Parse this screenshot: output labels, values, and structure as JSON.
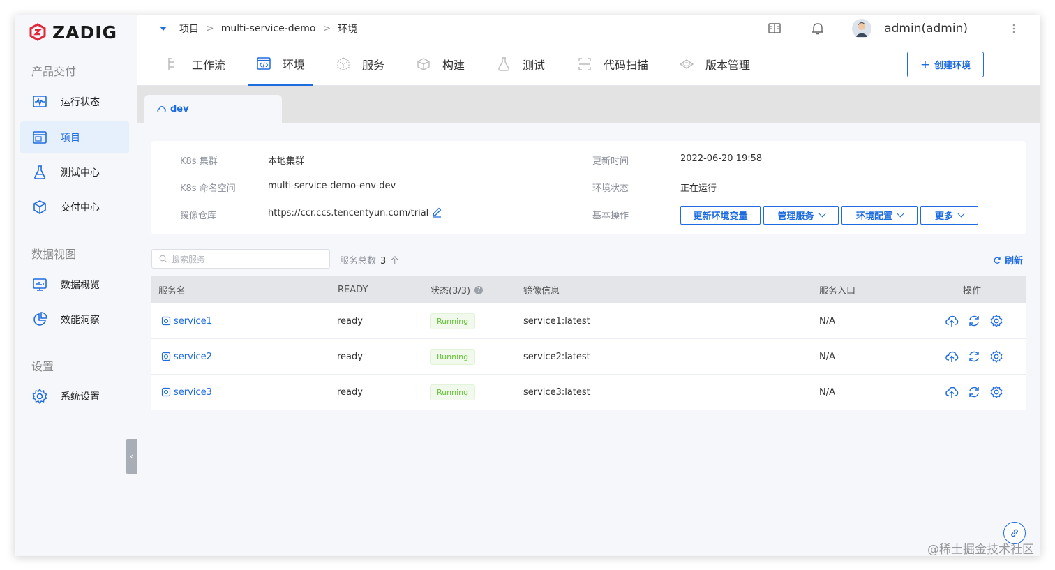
{
  "app": {
    "logo_text": "ZADIG"
  },
  "sidebar": {
    "sections": [
      "产品交付",
      "数据视图",
      "设置"
    ],
    "items": [
      {
        "label": "运行状态",
        "icon": "pulse-monitor-icon"
      },
      {
        "label": "项目",
        "icon": "pm-window-icon",
        "active": true
      },
      {
        "label": "测试中心",
        "icon": "flask-icon"
      },
      {
        "label": "交付中心",
        "icon": "package-icon"
      },
      {
        "label": "数据概览",
        "icon": "dashboard-monitor-icon"
      },
      {
        "label": "效能洞察",
        "icon": "pie-chart-icon"
      },
      {
        "label": "系统设置",
        "icon": "gear-icon"
      }
    ],
    "collapse_glyph": "‹"
  },
  "header": {
    "breadcrumb": [
      "项目",
      "multi-service-demo",
      "环境"
    ],
    "breadcrumb_sep": ">",
    "user": "admin(admin)"
  },
  "tabs": [
    {
      "label": "工作流",
      "icon": "workflow-icon"
    },
    {
      "label": "环境",
      "icon": "code-window-icon",
      "active": true
    },
    {
      "label": "服务",
      "icon": "cube-icon"
    },
    {
      "label": "构建",
      "icon": "box-icon"
    },
    {
      "label": "测试",
      "icon": "flask-icon"
    },
    {
      "label": "代码扫描",
      "icon": "scan-icon"
    },
    {
      "label": "版本管理",
      "icon": "version-icon"
    }
  ],
  "create_button": "创建环境",
  "env_tab": {
    "name": "dev"
  },
  "info": {
    "cluster_label": "K8s 集群",
    "cluster_value": "本地集群",
    "namespace_label": "K8s 命名空间",
    "namespace_value": "multi-service-demo-env-dev",
    "registry_label": "镜像仓库",
    "registry_value": "https://ccr.ccs.tencentyun.com/trial",
    "updated_label": "更新时间",
    "updated_value": "2022-06-20 19:58",
    "status_label": "环境状态",
    "status_value": "正在运行",
    "ops_label": "基本操作",
    "ops": {
      "update_vars": "更新环境变量",
      "manage_services": "管理服务",
      "env_config": "环境配置",
      "more": "更多"
    }
  },
  "search": {
    "placeholder": "搜索服务"
  },
  "total": {
    "label": "服务总数",
    "count": "3",
    "unit": "个"
  },
  "refresh_label": "刷新",
  "table": {
    "columns": {
      "name": "服务名",
      "ready": "READY",
      "status": "状态(3/3)",
      "image": "镜像信息",
      "entry": "服务入口",
      "ops": "操作"
    },
    "rows": [
      {
        "name": "service1",
        "ready": "ready",
        "status": "Running",
        "image": "service1:latest",
        "entry": "N/A"
      },
      {
        "name": "service2",
        "ready": "ready",
        "status": "Running",
        "image": "service2:latest",
        "entry": "N/A"
      },
      {
        "name": "service3",
        "ready": "ready",
        "status": "Running",
        "image": "service3:latest",
        "entry": "N/A"
      }
    ]
  },
  "watermark": "@稀土掘金技术社区",
  "colors": {
    "accent": "#1f6ce0",
    "running_text": "#67c23a",
    "running_bg": "#f0f9eb",
    "logo_red": "#e0283c"
  }
}
